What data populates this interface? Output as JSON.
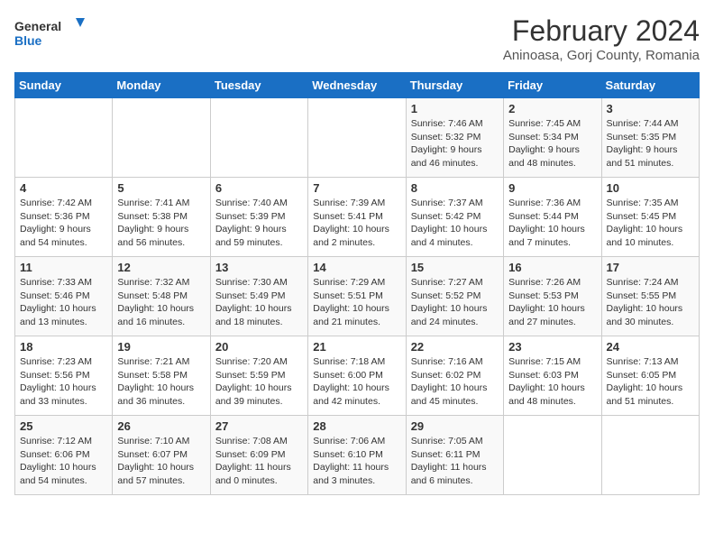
{
  "logo": {
    "line1": "General",
    "line2": "Blue"
  },
  "title": "February 2024",
  "subtitle": "Aninoasa, Gorj County, Romania",
  "days_header": [
    "Sunday",
    "Monday",
    "Tuesday",
    "Wednesday",
    "Thursday",
    "Friday",
    "Saturday"
  ],
  "weeks": [
    [
      {
        "day": "",
        "info": ""
      },
      {
        "day": "",
        "info": ""
      },
      {
        "day": "",
        "info": ""
      },
      {
        "day": "",
        "info": ""
      },
      {
        "day": "1",
        "info": "Sunrise: 7:46 AM\nSunset: 5:32 PM\nDaylight: 9 hours\nand 46 minutes."
      },
      {
        "day": "2",
        "info": "Sunrise: 7:45 AM\nSunset: 5:34 PM\nDaylight: 9 hours\nand 48 minutes."
      },
      {
        "day": "3",
        "info": "Sunrise: 7:44 AM\nSunset: 5:35 PM\nDaylight: 9 hours\nand 51 minutes."
      }
    ],
    [
      {
        "day": "4",
        "info": "Sunrise: 7:42 AM\nSunset: 5:36 PM\nDaylight: 9 hours\nand 54 minutes."
      },
      {
        "day": "5",
        "info": "Sunrise: 7:41 AM\nSunset: 5:38 PM\nDaylight: 9 hours\nand 56 minutes."
      },
      {
        "day": "6",
        "info": "Sunrise: 7:40 AM\nSunset: 5:39 PM\nDaylight: 9 hours\nand 59 minutes."
      },
      {
        "day": "7",
        "info": "Sunrise: 7:39 AM\nSunset: 5:41 PM\nDaylight: 10 hours\nand 2 minutes."
      },
      {
        "day": "8",
        "info": "Sunrise: 7:37 AM\nSunset: 5:42 PM\nDaylight: 10 hours\nand 4 minutes."
      },
      {
        "day": "9",
        "info": "Sunrise: 7:36 AM\nSunset: 5:44 PM\nDaylight: 10 hours\nand 7 minutes."
      },
      {
        "day": "10",
        "info": "Sunrise: 7:35 AM\nSunset: 5:45 PM\nDaylight: 10 hours\nand 10 minutes."
      }
    ],
    [
      {
        "day": "11",
        "info": "Sunrise: 7:33 AM\nSunset: 5:46 PM\nDaylight: 10 hours\nand 13 minutes."
      },
      {
        "day": "12",
        "info": "Sunrise: 7:32 AM\nSunset: 5:48 PM\nDaylight: 10 hours\nand 16 minutes."
      },
      {
        "day": "13",
        "info": "Sunrise: 7:30 AM\nSunset: 5:49 PM\nDaylight: 10 hours\nand 18 minutes."
      },
      {
        "day": "14",
        "info": "Sunrise: 7:29 AM\nSunset: 5:51 PM\nDaylight: 10 hours\nand 21 minutes."
      },
      {
        "day": "15",
        "info": "Sunrise: 7:27 AM\nSunset: 5:52 PM\nDaylight: 10 hours\nand 24 minutes."
      },
      {
        "day": "16",
        "info": "Sunrise: 7:26 AM\nSunset: 5:53 PM\nDaylight: 10 hours\nand 27 minutes."
      },
      {
        "day": "17",
        "info": "Sunrise: 7:24 AM\nSunset: 5:55 PM\nDaylight: 10 hours\nand 30 minutes."
      }
    ],
    [
      {
        "day": "18",
        "info": "Sunrise: 7:23 AM\nSunset: 5:56 PM\nDaylight: 10 hours\nand 33 minutes."
      },
      {
        "day": "19",
        "info": "Sunrise: 7:21 AM\nSunset: 5:58 PM\nDaylight: 10 hours\nand 36 minutes."
      },
      {
        "day": "20",
        "info": "Sunrise: 7:20 AM\nSunset: 5:59 PM\nDaylight: 10 hours\nand 39 minutes."
      },
      {
        "day": "21",
        "info": "Sunrise: 7:18 AM\nSunset: 6:00 PM\nDaylight: 10 hours\nand 42 minutes."
      },
      {
        "day": "22",
        "info": "Sunrise: 7:16 AM\nSunset: 6:02 PM\nDaylight: 10 hours\nand 45 minutes."
      },
      {
        "day": "23",
        "info": "Sunrise: 7:15 AM\nSunset: 6:03 PM\nDaylight: 10 hours\nand 48 minutes."
      },
      {
        "day": "24",
        "info": "Sunrise: 7:13 AM\nSunset: 6:05 PM\nDaylight: 10 hours\nand 51 minutes."
      }
    ],
    [
      {
        "day": "25",
        "info": "Sunrise: 7:12 AM\nSunset: 6:06 PM\nDaylight: 10 hours\nand 54 minutes."
      },
      {
        "day": "26",
        "info": "Sunrise: 7:10 AM\nSunset: 6:07 PM\nDaylight: 10 hours\nand 57 minutes."
      },
      {
        "day": "27",
        "info": "Sunrise: 7:08 AM\nSunset: 6:09 PM\nDaylight: 11 hours\nand 0 minutes."
      },
      {
        "day": "28",
        "info": "Sunrise: 7:06 AM\nSunset: 6:10 PM\nDaylight: 11 hours\nand 3 minutes."
      },
      {
        "day": "29",
        "info": "Sunrise: 7:05 AM\nSunset: 6:11 PM\nDaylight: 11 hours\nand 6 minutes."
      },
      {
        "day": "",
        "info": ""
      },
      {
        "day": "",
        "info": ""
      }
    ]
  ]
}
